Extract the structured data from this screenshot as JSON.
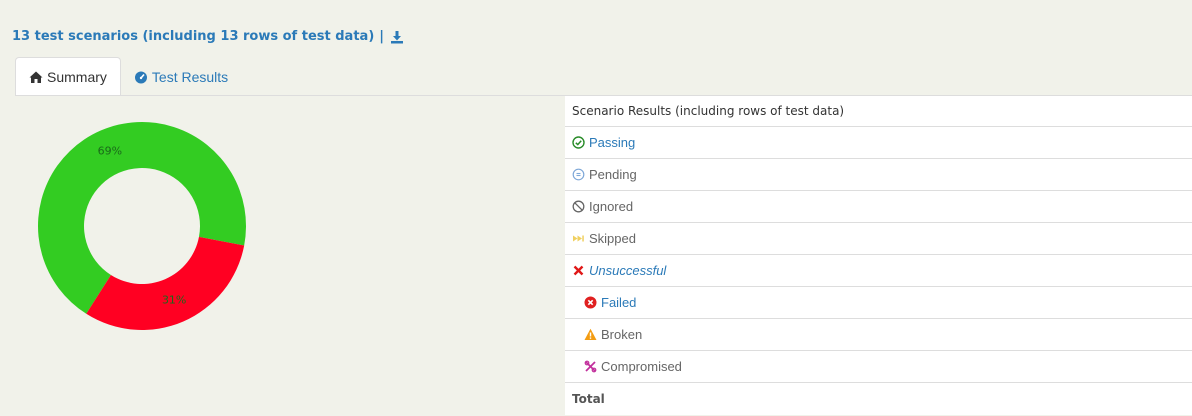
{
  "header": {
    "title": "13 test scenarios (including 13 rows of test data)",
    "separator": "|",
    "download_icon": "download-icon"
  },
  "tabs": [
    {
      "label": "Summary",
      "icon": "home-icon",
      "active": true
    },
    {
      "label": "Test Results",
      "icon": "dashboard-icon",
      "active": false
    }
  ],
  "results_table": {
    "header": "Scenario Results (including rows of test data)",
    "rows": [
      {
        "label": "Passing",
        "icon": "check-circle-icon"
      },
      {
        "label": "Pending",
        "icon": "pending-icon"
      },
      {
        "label": "Ignored",
        "icon": "ban-icon"
      },
      {
        "label": "Skipped",
        "icon": "fast-forward-icon"
      },
      {
        "label": "Unsuccessful",
        "icon": "x-icon"
      },
      {
        "label": "Failed",
        "icon": "times-circle-icon"
      },
      {
        "label": "Broken",
        "icon": "warning-icon"
      },
      {
        "label": "Compromised",
        "icon": "chain-broken-icon"
      }
    ],
    "total_label": "Total"
  },
  "colors": {
    "passing": "#33cc22",
    "failed": "#ff0022",
    "link": "#2b7ab8"
  },
  "chart_data": {
    "type": "pie",
    "donut": true,
    "slices": [
      {
        "label": "69%",
        "value": 69,
        "color": "#33cc22"
      },
      {
        "label": "31%",
        "value": 31,
        "color": "#ff0022"
      }
    ]
  }
}
